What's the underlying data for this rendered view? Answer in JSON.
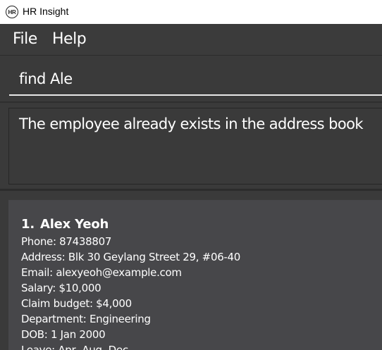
{
  "window": {
    "title": "HR Insight",
    "icon_text": "HR"
  },
  "menu": {
    "items": [
      "File",
      "Help"
    ]
  },
  "command": {
    "value": "find Ale"
  },
  "result": {
    "message": "The employee already exists in the address book"
  },
  "employees": [
    {
      "index": "1.",
      "name": "Alex Yeoh",
      "phone": "Phone: 87438807",
      "address": "Address: Blk 30 Geylang Street 29, #06-40",
      "email": "Email: alexyeoh@example.com",
      "salary": "Salary: $10,000",
      "claim_budget": "Claim budget: $4,000",
      "department": "Department: Engineering",
      "dob": "DOB: 1 Jan 2000",
      "leave": "Leave: Apr, Aug, Dec"
    }
  ]
}
